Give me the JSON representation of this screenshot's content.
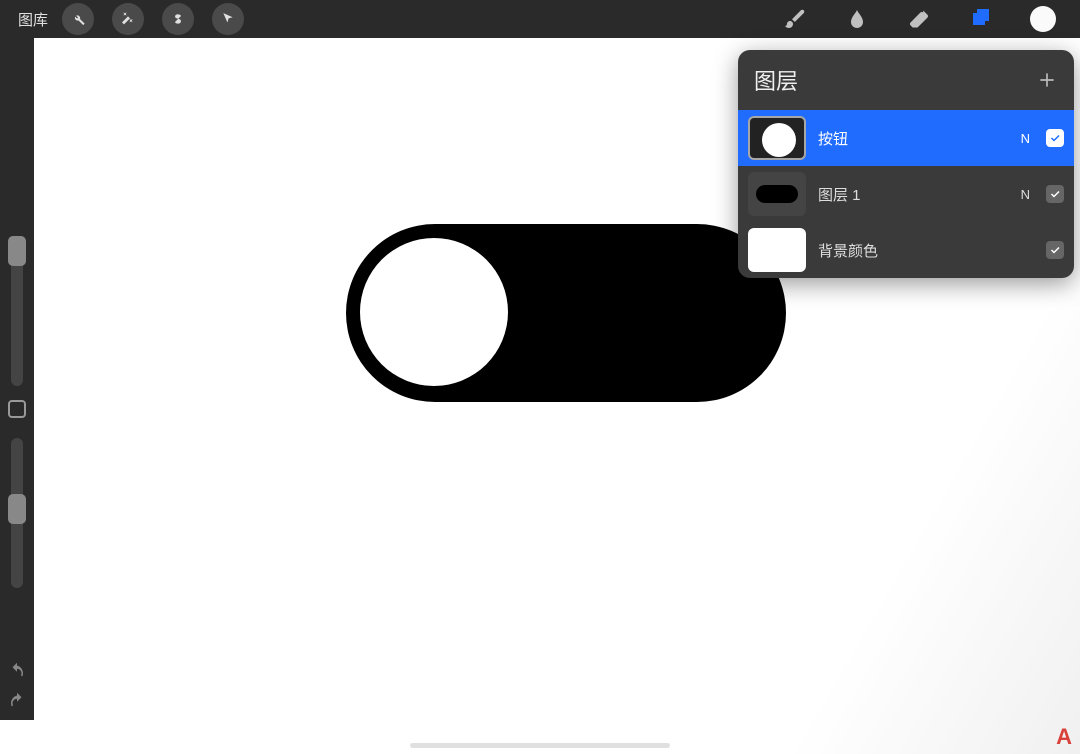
{
  "toolbar": {
    "gallery_label": "图库"
  },
  "layers_panel": {
    "title": "图层",
    "rows": [
      {
        "name": "按钮",
        "blend": "N",
        "selected": true
      },
      {
        "name": "图层 1",
        "blend": "N",
        "selected": false
      },
      {
        "name": "背景颜色",
        "blend": "",
        "selected": false
      }
    ]
  },
  "colors": {
    "accent": "#1f6cff",
    "current_color": "#fafafa"
  }
}
